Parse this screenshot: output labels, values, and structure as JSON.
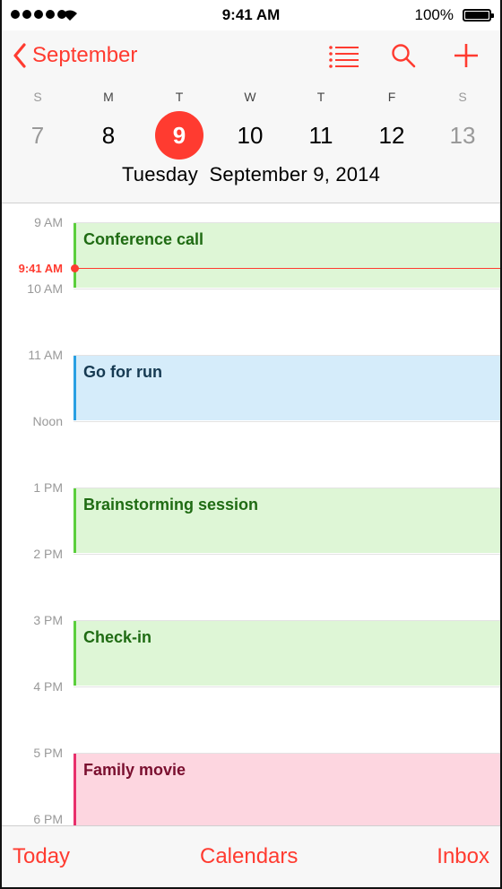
{
  "status_bar": {
    "time": "9:41 AM",
    "battery": "100%",
    "signal_bars": 5
  },
  "header": {
    "back_label": "September",
    "icons": [
      "list-icon",
      "search-icon",
      "add-icon"
    ],
    "weekdays": [
      "S",
      "M",
      "T",
      "W",
      "T",
      "F",
      "S"
    ],
    "dates": [
      "7",
      "8",
      "9",
      "10",
      "11",
      "12",
      "13"
    ],
    "selected_date": "9",
    "full_date": "Tuesday  September 9, 2014"
  },
  "timeline": {
    "hours": [
      "9 AM",
      "10 AM",
      "11 AM",
      "Noon",
      "1 PM",
      "2 PM",
      "3 PM",
      "4 PM",
      "5 PM",
      "6 PM"
    ],
    "now_label": "9:41 AM",
    "events": [
      {
        "title": "Conference call",
        "start": "9 AM",
        "end": "10 AM",
        "color": "green"
      },
      {
        "title": "Go for run",
        "start": "11 AM",
        "end": "Noon",
        "color": "blue"
      },
      {
        "title": "Brainstorming session",
        "start": "1 PM",
        "end": "2 PM",
        "color": "green"
      },
      {
        "title": "Check-in",
        "start": "3 PM",
        "end": "4 PM",
        "color": "green"
      },
      {
        "title": "Family movie",
        "start": "5 PM",
        "end": "",
        "color": "pink"
      }
    ]
  },
  "tabbar": {
    "today": "Today",
    "calendars": "Calendars",
    "inbox": "Inbox"
  },
  "colors": {
    "accent": "#ff3b30",
    "green_event": "#def6d6",
    "blue_event": "#d5ecfa",
    "pink_event": "#fdd6e0"
  }
}
